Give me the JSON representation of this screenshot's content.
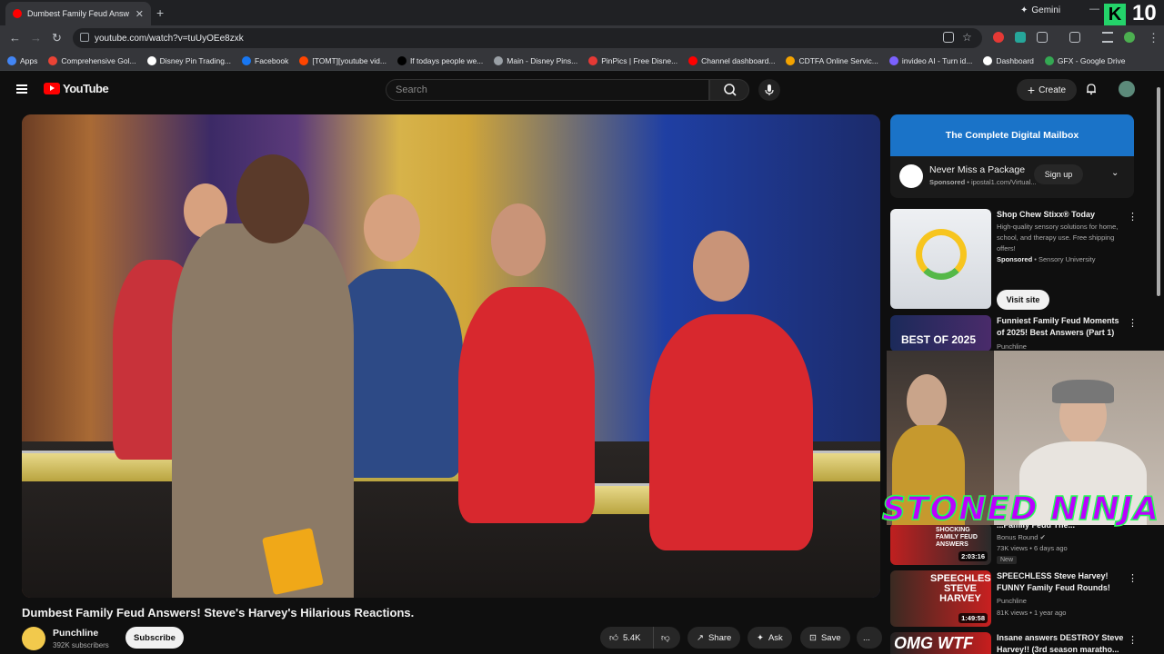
{
  "browser": {
    "tab_title": "Dumbest Family Feud Answ",
    "new_tab": "+",
    "gemini_label": "Gemini",
    "badge_letter": "K",
    "badge_number": "10",
    "url": "youtube.com/watch?v=tuUyOEe8zxk"
  },
  "bookmarks": [
    {
      "label": "Apps",
      "color": "#4285f4"
    },
    {
      "label": "Comprehensive Gol...",
      "color": "#ea4335"
    },
    {
      "label": "Disney Pin Trading...",
      "color": "#ffffff"
    },
    {
      "label": "Facebook",
      "color": "#1877f2"
    },
    {
      "label": "[TOMT][youtube vid...",
      "color": "#ff4500"
    },
    {
      "label": "If todays people we...",
      "color": "#000000"
    },
    {
      "label": "Main - Disney Pins...",
      "color": "#9aa0a6"
    },
    {
      "label": "PinPics | Free Disne...",
      "color": "#e53935"
    },
    {
      "label": "Channel dashboard...",
      "color": "#ff0000"
    },
    {
      "label": "CDTFA Online Servic...",
      "color": "#f4a300"
    },
    {
      "label": "invideo AI - Turn id...",
      "color": "#7b61ff"
    },
    {
      "label": "Dashboard",
      "color": "#ffffff"
    },
    {
      "label": "GFX - Google Drive",
      "color": "#34a853"
    }
  ],
  "youtube": {
    "logo_text": "YouTube",
    "search_placeholder": "Search",
    "create_label": "Create"
  },
  "video": {
    "title": "Dumbest Family Feud Answers! Steve's Harvey's Hilarious Reactions.",
    "channel": "Punchline",
    "subscribers": "392K subscribers",
    "subscribe_label": "Subscribe",
    "likes": "5.4K",
    "share_label": "Share",
    "ask_label": "Ask",
    "save_label": "Save",
    "more_label": "..."
  },
  "ad": {
    "banner": "The Complete Digital Mailbox",
    "title": "Never Miss a Package",
    "sponsored": "Sponsored",
    "domain": "ipostal1.com/Virtual...",
    "signup": "Sign up"
  },
  "recommendations": [
    {
      "title": "Shop Chew Stixx® Today",
      "desc": "High-quality sensory solutions for home, school, and therapy use. Free shipping offers!",
      "sponsored": "Sponsored",
      "channel": "Sensory University",
      "cta": "Visit site"
    },
    {
      "title": "Funniest Family Feud Moments of 2025! Best Answers (Part 1)",
      "channel": "Punchline",
      "thumb_text": "BEST OF 2025"
    },
    {
      "title": "...Family Feud The...",
      "channel": "Bonus Round",
      "meta": "73K views • 6 days ago",
      "badge": "New",
      "duration": "2:03:16",
      "thumb_text": "SHOCKING FAMILY FEUD ANSWERS"
    },
    {
      "title": "SPEECHLESS Steve Harvey! FUNNY Family Feud Rounds!",
      "channel": "Punchline",
      "meta": "81K views • 1 year ago",
      "duration": "1:49:58",
      "thumb_text": "SPEECHLESS STEVE HARVEY"
    },
    {
      "title": "Insane answers DESTROY Steve Harvey!! (3rd season maratho...",
      "thumb_text": "OMG WTF"
    }
  ],
  "overlay": {
    "text": "STONED NINJA"
  }
}
